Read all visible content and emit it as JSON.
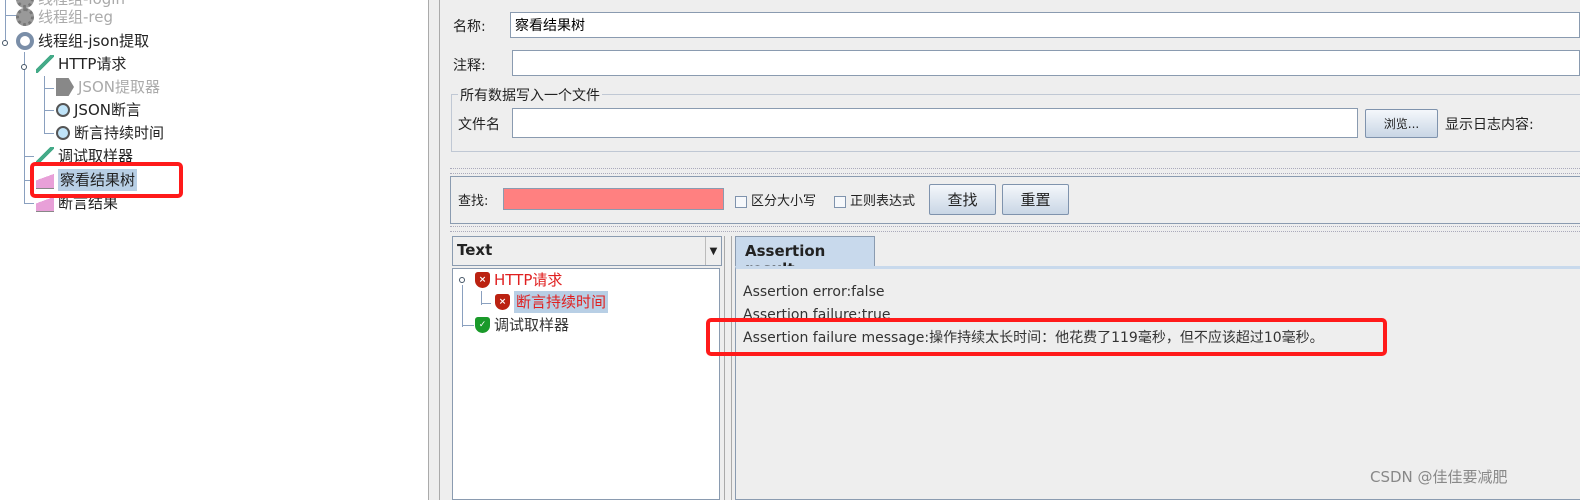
{
  "tree": [
    {
      "label": "线程组-login",
      "state": "disabled",
      "icon": "gear-icon"
    },
    {
      "label": "线程组-reg",
      "state": "disabled",
      "icon": "gear-icon"
    },
    {
      "label": "线程组-json提取",
      "state": "enabled",
      "icon": "gear-icon"
    },
    {
      "label": "HTTP请求",
      "state": "enabled",
      "icon": "dropper-icon"
    },
    {
      "label": "JSON提取器",
      "state": "disabled",
      "icon": "extractor-icon"
    },
    {
      "label": "JSON断言",
      "state": "enabled",
      "icon": "magnifier-icon"
    },
    {
      "label": "断言持续时间",
      "state": "enabled",
      "icon": "magnifier-icon"
    },
    {
      "label": "调试取样器",
      "state": "enabled",
      "icon": "dropper-icon"
    },
    {
      "label": "察看结果树",
      "state": "selected",
      "icon": "graph-icon"
    },
    {
      "label": "断言结果",
      "state": "enabled",
      "icon": "graph-icon"
    }
  ],
  "form": {
    "name_label": "名称:",
    "name_value": "察看结果树",
    "comment_label": "注释:",
    "comment_value": "",
    "group_title": "所有数据写入一个文件",
    "file_label": "文件名",
    "file_value": "",
    "browse": "浏览...",
    "log_label": "显示日志内容:"
  },
  "search": {
    "label": "查找:",
    "value": "",
    "case": "区分大小写",
    "regex": "正则表达式",
    "find": "查找",
    "reset": "重置",
    "field_color": "#ff8080"
  },
  "results": {
    "renderer": "Text",
    "items": [
      {
        "label": "HTTP请求",
        "status": "fail"
      },
      {
        "label": "断言持续时间",
        "status": "fail"
      },
      {
        "label": "调试取样器",
        "status": "pass"
      }
    ],
    "tab": "Assertion result",
    "lines": [
      "Assertion error:false",
      "Assertion failure:true",
      "Assertion failure message:操作持续太长时间：他花费了119毫秒，但不应该超过10毫秒。"
    ]
  },
  "watermark": "CSDN @佳佳要减肥",
  "colors": {
    "annotation": "#ff1a1a",
    "fail": "#e02020",
    "selection": "#b8cfe5"
  }
}
